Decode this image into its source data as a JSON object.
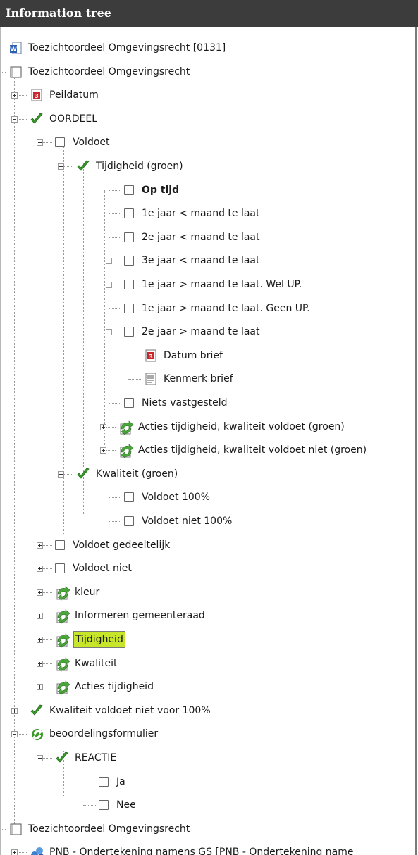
{
  "panel": {
    "title": "Information tree"
  },
  "items": [
    {
      "label": "Toezichtoordeel Omgevingsrecht [0131]",
      "icon": "word-document-icon"
    },
    {
      "label": "Toezichtoordeel Omgevingsrecht",
      "icon": "folder-outline-icon"
    },
    {
      "label": "Peildatum",
      "icon": "calendar-icon"
    },
    {
      "label": "OORDEEL",
      "icon": "green-check-icon"
    },
    {
      "label": "Voldoet",
      "icon": "checkbox-icon"
    },
    {
      "label": "Tijdigheid (groen)",
      "icon": "green-check-icon"
    },
    {
      "label": "Op tijd",
      "icon": "checkbox-icon"
    },
    {
      "label": "1e jaar < maand te laat",
      "icon": "checkbox-icon"
    },
    {
      "label": "2e jaar < maand  te laat",
      "icon": "checkbox-icon"
    },
    {
      "label": "3e jaar < maand te laat",
      "icon": "checkbox-icon"
    },
    {
      "label": "1e jaar > maand te laat. Wel UP.",
      "icon": "checkbox-icon"
    },
    {
      "label": "1e jaar > maand te laat. Geen UP.",
      "icon": "checkbox-icon"
    },
    {
      "label": "2e jaar > maand te laat",
      "icon": "checkbox-icon"
    },
    {
      "label": "Datum brief",
      "icon": "calendar-icon"
    },
    {
      "label": "Kenmerk brief",
      "icon": "text-field-icon"
    },
    {
      "label": "Niets vastgesteld",
      "icon": "checkbox-icon"
    },
    {
      "label": "Acties tijdigheid, kwaliteit voldoet (groen)",
      "icon": "action-arrows-icon"
    },
    {
      "label": "Acties tijdigheid, kwaliteit voldoet niet (groen)",
      "icon": "action-arrows-icon"
    },
    {
      "label": "Kwaliteit (groen)",
      "icon": "green-check-icon"
    },
    {
      "label": "Voldoet 100%",
      "icon": "checkbox-icon"
    },
    {
      "label": "Voldoet niet 100%",
      "icon": "checkbox-icon"
    },
    {
      "label": "Voldoet gedeeltelijk",
      "icon": "checkbox-icon"
    },
    {
      "label": "Voldoet niet",
      "icon": "checkbox-icon"
    },
    {
      "label": "kleur",
      "icon": "action-arrows-icon"
    },
    {
      "label": "Informeren gemeenteraad",
      "icon": "action-arrows-icon"
    },
    {
      "label": "Tijdigheid",
      "icon": "action-arrows-icon"
    },
    {
      "label": "Kwaliteit",
      "icon": "action-arrows-icon"
    },
    {
      "label": "Acties tijdigheid",
      "icon": "action-arrows-icon"
    },
    {
      "label": "Kwaliteit voldoet niet voor 100%",
      "icon": "green-check-icon"
    },
    {
      "label": "beoordelingsformulier",
      "icon": "green-form-icon"
    },
    {
      "label": "REACTIE",
      "icon": "green-check-icon"
    },
    {
      "label": "Ja",
      "icon": "checkbox-icon"
    },
    {
      "label": "Nee",
      "icon": "checkbox-icon"
    },
    {
      "label": "Toezichtoordeel Omgevingsrecht",
      "icon": "folder-outline-icon"
    },
    {
      "label": "PNB - Ondertekening namens GS [PNB - Ondertekening name",
      "icon": "blue-workflow-icon"
    }
  ],
  "colors": {
    "titlebar": "#3c3c3c",
    "highlight": "#c7e62a",
    "check_green": "#3a9a2a"
  }
}
